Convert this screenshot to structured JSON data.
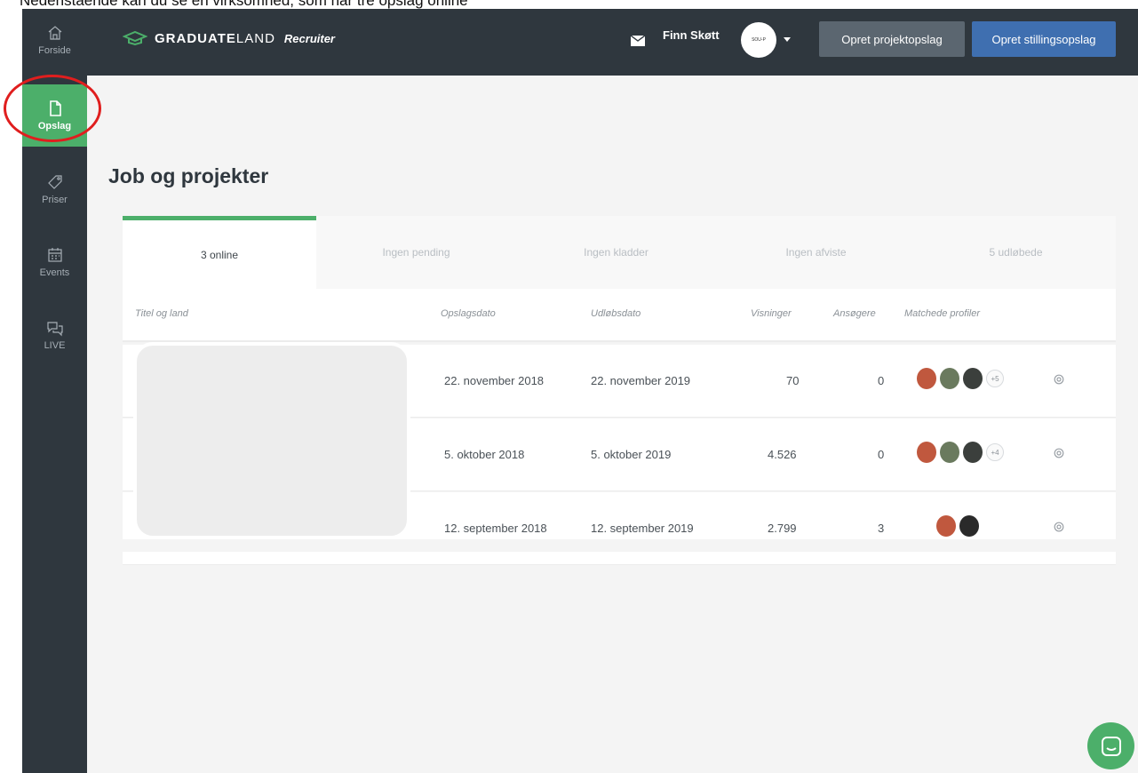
{
  "caption": "Nedenstående kan du se en virksomhed, som har tre opslag online",
  "sidebar": {
    "items": [
      {
        "label": "Forside",
        "icon": "home-icon"
      },
      {
        "label": "Opslag",
        "icon": "document-icon",
        "active": true
      },
      {
        "label": "Priser",
        "icon": "tag-icon"
      },
      {
        "label": "Events",
        "icon": "calendar-icon"
      },
      {
        "label": "LIVE",
        "icon": "chat-bubbles-icon"
      }
    ]
  },
  "header": {
    "brand_bold": "GRADUATE",
    "brand_light": "LAND",
    "brand_product": "Recruiter",
    "user_name": "Finn Skøtt",
    "avatar_text": "SOU-P",
    "create_project_label": "Opret projektopslag",
    "create_job_label": "Opret stillingsopslag"
  },
  "page": {
    "title": "Job og projekter"
  },
  "tabs": [
    {
      "label": "3 online",
      "active": true
    },
    {
      "label": "Ingen pending"
    },
    {
      "label": "Ingen kladder"
    },
    {
      "label": "Ingen afviste"
    },
    {
      "label": "5 udløbede"
    }
  ],
  "table": {
    "columns": [
      "Titel og land",
      "Opslagsdato",
      "Udløbsdato",
      "Visninger",
      "Ansøgere",
      "Matchede profiler"
    ],
    "rows": [
      {
        "posted": "22. november 2018",
        "expires": "22. november 2019",
        "views": "70",
        "applicants": "0",
        "more": "+5",
        "faces": 3
      },
      {
        "posted": "5. oktober 2018",
        "expires": "5. oktober 2019",
        "views": "4.526",
        "applicants": "0",
        "more": "+4",
        "faces": 3
      },
      {
        "posted": "12. september 2018",
        "expires": "12. september 2019",
        "views": "2.799",
        "applicants": "3",
        "more": "",
        "faces": 2
      }
    ]
  },
  "colors": {
    "sidebar_bg": "#2f373e",
    "accent_green": "#4caf6a",
    "primary_blue": "#3f6fb0",
    "annotation_red": "#e01e1e"
  }
}
